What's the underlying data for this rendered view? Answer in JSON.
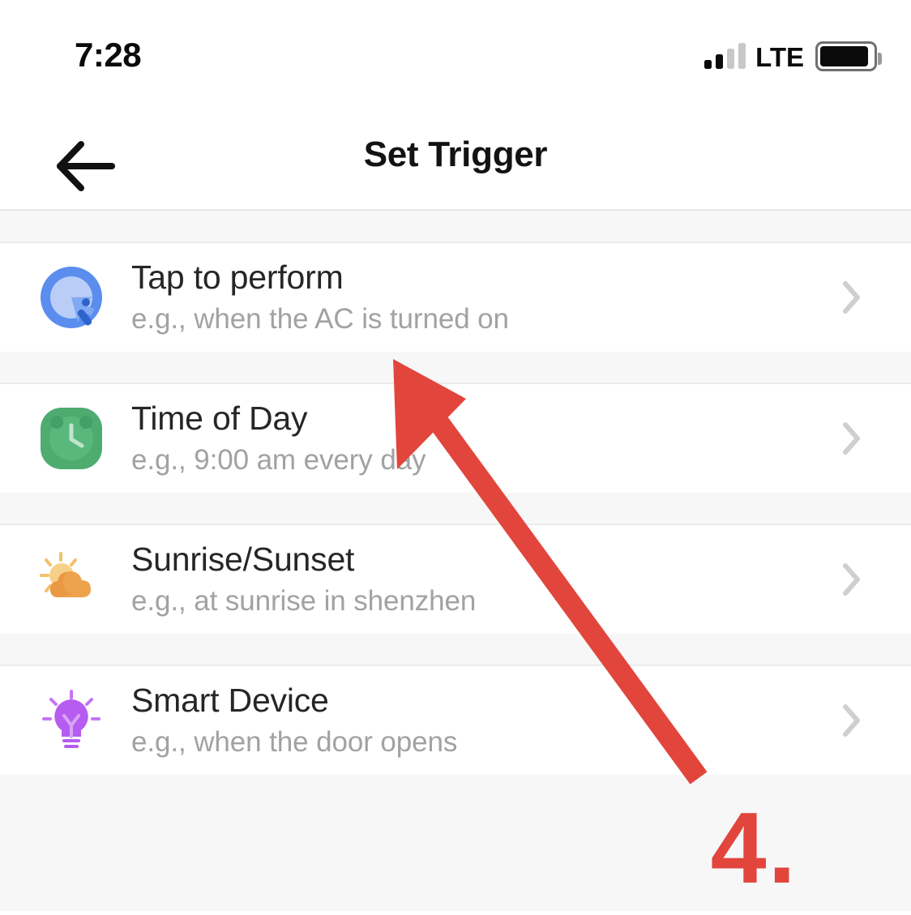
{
  "status_bar": {
    "time": "7:28",
    "network_label": "LTE",
    "signal_bars_filled": 2,
    "signal_bars_total": 4,
    "battery_level_percent": 92
  },
  "nav": {
    "title": "Set Trigger",
    "back_icon": "arrow-left-icon"
  },
  "colors": {
    "annotation_red": "#e2453c",
    "tap_icon_blue": "#5b8def",
    "clock_icon_green": "#4eac71",
    "sun_icon_orange": "#efa14a",
    "bulb_icon_purple": "#b65cf0",
    "title_text": "#262626",
    "subtitle_text": "#a2a2a2",
    "page_background": "#f7f7f7"
  },
  "list": {
    "rows": [
      {
        "icon": "tap-cursor-icon",
        "title": "Tap to perform",
        "subtitle": "e.g., when the AC is turned on",
        "chevron": "chevron-right-icon"
      },
      {
        "icon": "alarm-clock-icon",
        "title": "Time of Day",
        "subtitle": "e.g., 9:00 am every day",
        "chevron": "chevron-right-icon"
      },
      {
        "icon": "sun-cloud-icon",
        "title": "Sunrise/Sunset",
        "subtitle": "e.g., at sunrise in shenzhen",
        "chevron": "chevron-right-icon"
      },
      {
        "icon": "lightbulb-icon",
        "title": "Smart Device",
        "subtitle": "e.g., when the door opens",
        "chevron": "chevron-right-icon"
      }
    ]
  },
  "annotation": {
    "step_label": "4.",
    "arrow_points_to": "Tap to perform"
  }
}
